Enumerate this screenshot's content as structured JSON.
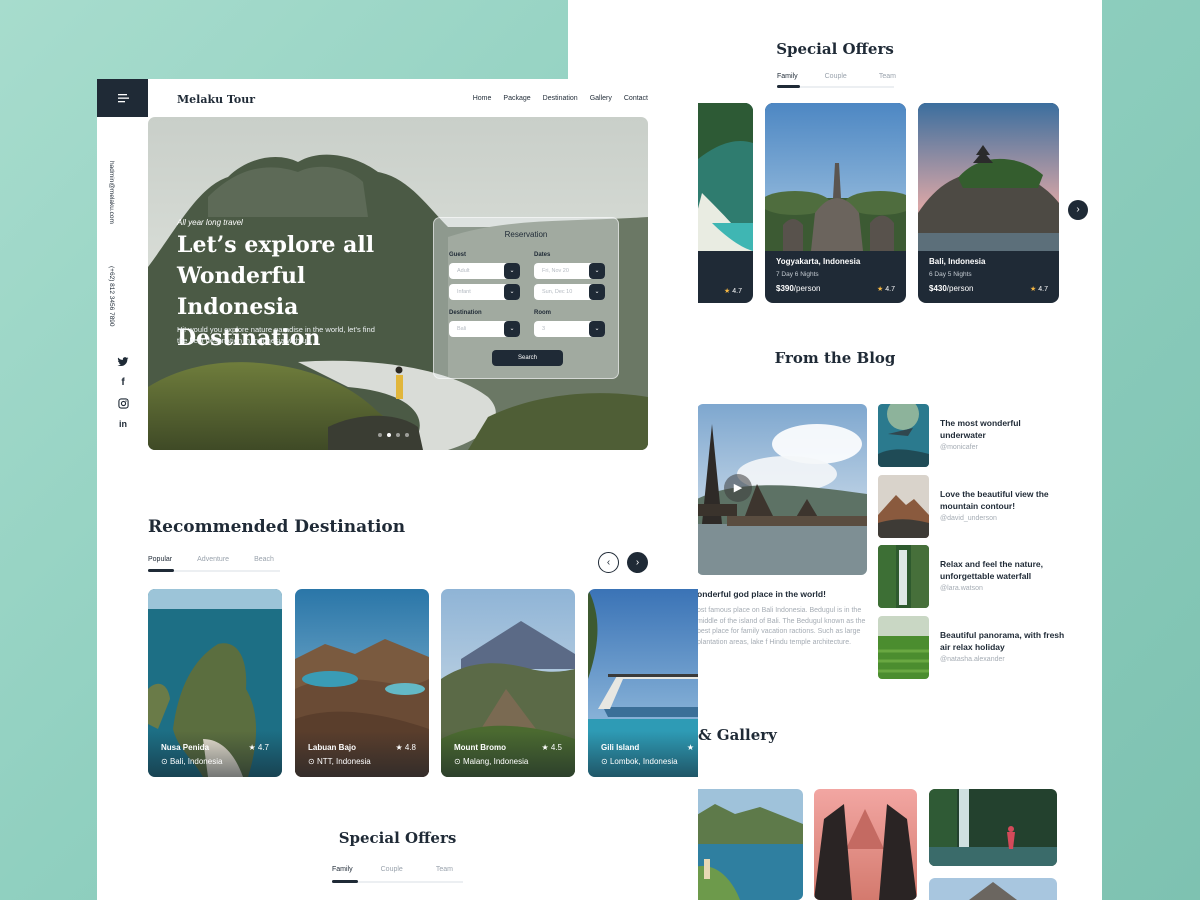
{
  "back": {
    "special_offers_title": "Special Offers",
    "tabs": [
      "Family",
      "Couple",
      "Team"
    ],
    "offers": [
      {
        "name": "",
        "duration": "",
        "price": "",
        "unit": "",
        "rating": "4.7"
      },
      {
        "name": "Yogyakarta, Indonesia",
        "duration": "7 Day 6 Nights",
        "price": "$390",
        "unit": "/person",
        "rating": "4.7"
      },
      {
        "name": "Bali, Indonesia",
        "duration": "6 Day 5 Nights",
        "price": "$430",
        "unit": "/person",
        "rating": "4.7"
      }
    ],
    "next_icon": "›",
    "blog_title": "From the Blog",
    "blog_main": {
      "title": "onderful god place in the world!",
      "text": "ost famous place on Bali Indonesia. Bedugul is in the middle of the island of Bali. The Bedugul known as the best place for family vacation ractions. Such as large plantation areas, lake f Hindu temple architecture."
    },
    "blog_items": [
      {
        "title": "The most wonderful underwater",
        "author": "@monicafer"
      },
      {
        "title": "Love the beautiful view the mountain contour!",
        "author": "@david_underson"
      },
      {
        "title": "Relax and feel the nature, unforgettable waterfall",
        "author": "@lara.watson"
      },
      {
        "title": "Beautiful panorama, with fresh air relax holiday",
        "author": "@natasha.alexander"
      }
    ],
    "gallery_title": "& Gallery"
  },
  "front": {
    "brand": "Melaku Tour",
    "nav": [
      "Home",
      "Package",
      "Destination",
      "Gallery",
      "Contact"
    ],
    "email": "hadmin@melaku.com",
    "phone": "(+62) 812 3456 7890",
    "social_icons": [
      "twitter-icon",
      "facebook-icon",
      "instagram-icon",
      "linkedin-icon"
    ],
    "hero": {
      "tag": "All year long travel",
      "title": "Let’s explore all Wonderful Indonesia Destination",
      "desc": "Hi! would you explore nature paradise in the world, let’s find the best destination in Indonesia with us."
    },
    "reservation": {
      "title": "Reservation",
      "guest_label": "Guest",
      "dates_label": "Dates",
      "adult": "Adult",
      "infant": "Infant",
      "date_in": "Fri, Nov 20",
      "date_out": "Sun, Dec 10",
      "destination_label": "Destination",
      "destination": "Bali",
      "room_label": "Room",
      "room": "3",
      "search": "Search"
    },
    "recommended_title": "Recommended Destination",
    "rec_tabs": [
      "Popular",
      "Adventure",
      "Beach"
    ],
    "destinations": [
      {
        "name": "Nusa Penida",
        "rating": "4.7",
        "location": "Bali, Indonesia"
      },
      {
        "name": "Labuan Bajo",
        "rating": "4.8",
        "location": "NTT, Indonesia"
      },
      {
        "name": "Mount Bromo",
        "rating": "4.5",
        "location": "Malang, Indonesia"
      },
      {
        "name": "Gili Island",
        "rating": "",
        "location": "Lombok, Indonesia"
      }
    ],
    "special_offers_title": "Special Offers",
    "so_tabs": [
      "Family",
      "Couple",
      "Team"
    ],
    "prev_icon": "‹",
    "next_icon": "›"
  },
  "colors": {
    "dark": "#1f2a36",
    "star": "#f4b642",
    "bg": "#a7dccd"
  }
}
